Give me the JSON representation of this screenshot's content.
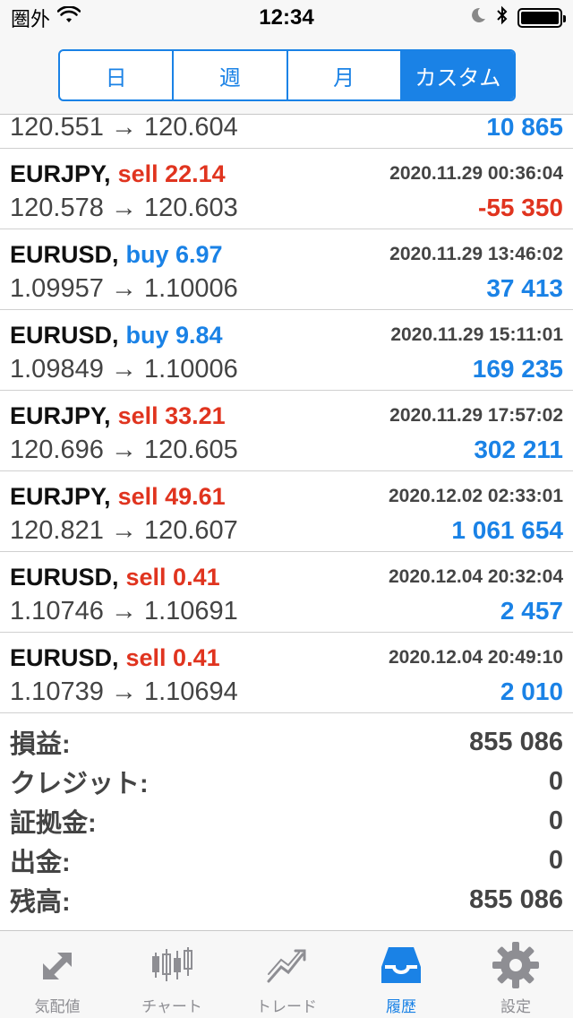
{
  "status_bar": {
    "carrier": "圏外",
    "time": "12:34"
  },
  "segmented": {
    "options": [
      "日",
      "週",
      "月",
      "カスタム"
    ],
    "selected": "カスタム"
  },
  "partial_trade": {
    "prices": "120.551 → 120.604",
    "profit": "10 865"
  },
  "trades": [
    {
      "symbol": "EURJPY,",
      "side": "sell 22.14",
      "side_type": "sell",
      "time": "2020.11.29 00:36:04",
      "prices": "120.578 → 120.603",
      "profit": "-55 350",
      "profit_type": "neg"
    },
    {
      "symbol": "EURUSD,",
      "side": "buy 6.97",
      "side_type": "buy",
      "time": "2020.11.29 13:46:02",
      "prices": "1.09957 → 1.10006",
      "profit": "37 413",
      "profit_type": "pos"
    },
    {
      "symbol": "EURUSD,",
      "side": "buy 9.84",
      "side_type": "buy",
      "time": "2020.11.29 15:11:01",
      "prices": "1.09849 → 1.10006",
      "profit": "169 235",
      "profit_type": "pos"
    },
    {
      "symbol": "EURJPY,",
      "side": "sell 33.21",
      "side_type": "sell",
      "time": "2020.11.29 17:57:02",
      "prices": "120.696 → 120.605",
      "profit": "302 211",
      "profit_type": "pos"
    },
    {
      "symbol": "EURJPY,",
      "side": "sell 49.61",
      "side_type": "sell",
      "time": "2020.12.02 02:33:01",
      "prices": "120.821 → 120.607",
      "profit": "1 061 654",
      "profit_type": "pos"
    },
    {
      "symbol": "EURUSD,",
      "side": "sell 0.41",
      "side_type": "sell",
      "time": "2020.12.04 20:32:04",
      "prices": "1.10746 → 1.10691",
      "profit": "2 457",
      "profit_type": "pos"
    },
    {
      "symbol": "EURUSD,",
      "side": "sell 0.41",
      "side_type": "sell",
      "time": "2020.12.04 20:49:10",
      "prices": "1.10739 → 1.10694",
      "profit": "2 010",
      "profit_type": "pos"
    }
  ],
  "summary": [
    {
      "label": "損益:",
      "value": "855 086"
    },
    {
      "label": "クレジット:",
      "value": "0"
    },
    {
      "label": "証拠金:",
      "value": "0"
    },
    {
      "label": "出金:",
      "value": "0"
    },
    {
      "label": "残高:",
      "value": "855 086"
    }
  ],
  "tabs": [
    {
      "label": "気配値",
      "icon": "quotes-arrows-icon"
    },
    {
      "label": "チャート",
      "icon": "candlestick-chart-icon"
    },
    {
      "label": "トレード",
      "icon": "trade-trend-icon"
    },
    {
      "label": "履歴",
      "icon": "history-inbox-icon",
      "active": true
    },
    {
      "label": "設定",
      "icon": "gear-icon"
    }
  ],
  "colors": {
    "accent": "#1a82e6",
    "sell": "#e0341f",
    "inactive_tab": "#8e8e93"
  }
}
